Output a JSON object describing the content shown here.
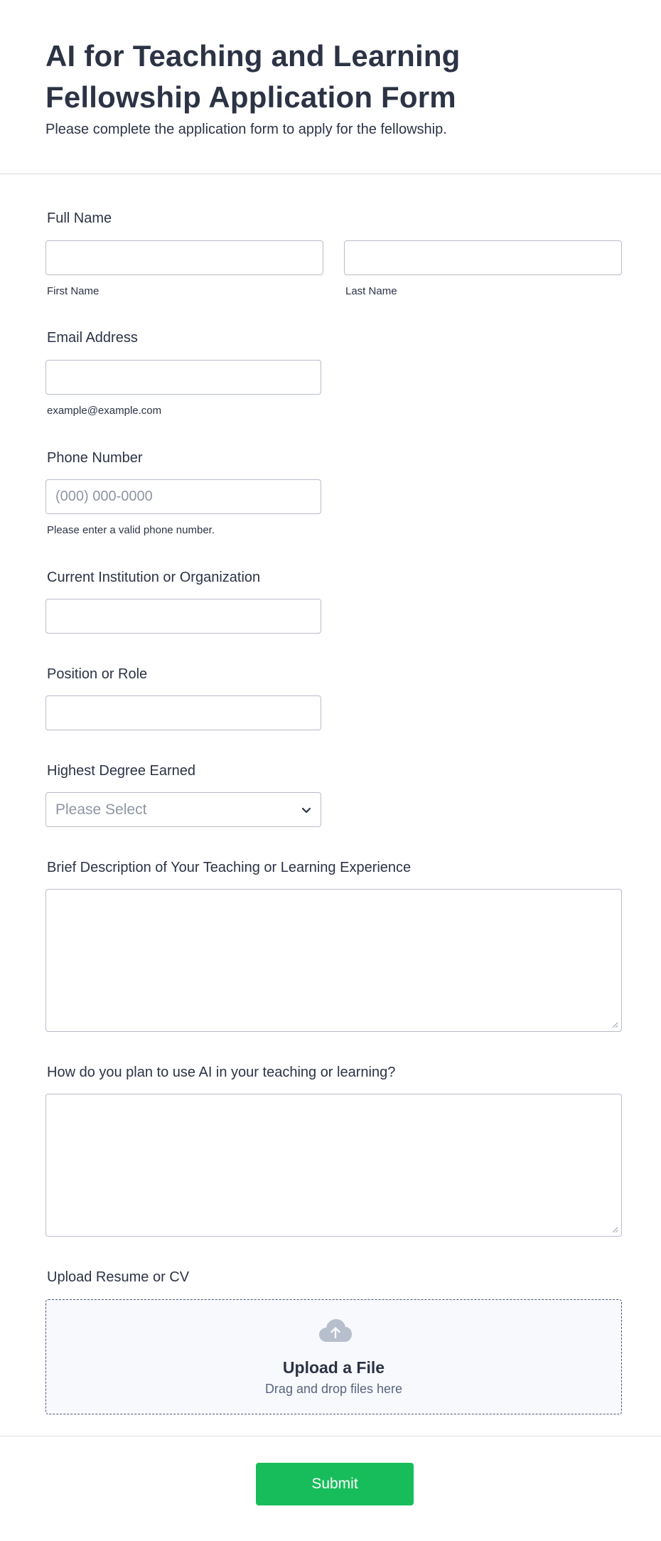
{
  "header": {
    "title": "AI for Teaching and Learning Fellowship Application Form",
    "subtitle": "Please complete the application form to apply for the fellowship."
  },
  "fields": {
    "full_name": {
      "label": "Full Name",
      "first_value": "",
      "first_sublabel": "First Name",
      "last_value": "",
      "last_sublabel": "Last Name"
    },
    "email": {
      "label": "Email Address",
      "value": "",
      "sublabel": "example@example.com"
    },
    "phone": {
      "label": "Phone Number",
      "value": "",
      "placeholder": "(000) 000-0000",
      "sublabel": "Please enter a valid phone number."
    },
    "institution": {
      "label": "Current Institution or Organization",
      "value": ""
    },
    "position": {
      "label": "Position or Role",
      "value": ""
    },
    "degree": {
      "label": "Highest Degree Earned",
      "selected": "Please Select",
      "icon": "chevron-down-icon"
    },
    "experience": {
      "label": "Brief Description of Your Teaching or Learning Experience",
      "value": ""
    },
    "ai_plan": {
      "label": "How do you plan to use AI in your teaching or learning?",
      "value": ""
    },
    "resume": {
      "label": "Upload Resume or CV",
      "title": "Upload a File",
      "subtitle": "Drag and drop files here",
      "icon": "cloud-upload-icon"
    }
  },
  "submit": {
    "label": "Submit",
    "color": "#18bd5b"
  },
  "colors": {
    "text": "#2c3345",
    "border": "#b8bdc9",
    "placeholder": "#8f96a3",
    "upload_bg": "#f8f9fc"
  }
}
